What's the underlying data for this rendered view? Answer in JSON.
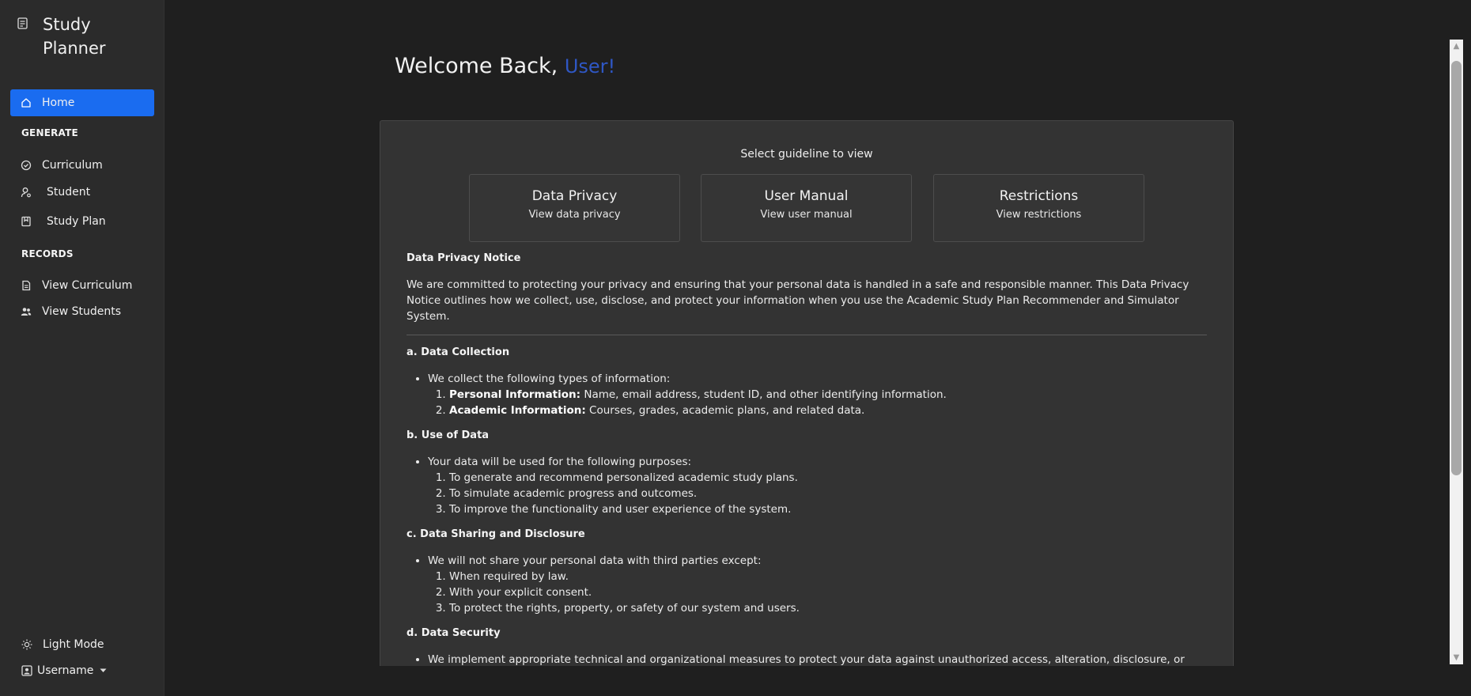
{
  "app": {
    "title": "Study Planner"
  },
  "sidebar": {
    "home": "Home",
    "generate_label": "GENERATE",
    "generate_items": [
      "Curriculum",
      "Student",
      "Study Plan"
    ],
    "records_label": "RECORDS",
    "records_items": [
      "View Curriculum",
      "View Students"
    ],
    "light_mode": "Light Mode",
    "username": "Username",
    "accent": "#1a6cf0"
  },
  "main": {
    "welcome": "Welcome Back,",
    "user": "User!",
    "select_label": "Select guideline to view",
    "cards": [
      {
        "title": "Data Privacy",
        "subtitle": "View data privacy"
      },
      {
        "title": "User Manual",
        "subtitle": "View user manual"
      },
      {
        "title": "Restrictions",
        "subtitle": "View restrictions"
      }
    ],
    "notice": {
      "heading": "Data Privacy Notice",
      "intro": "We are committed to protecting your privacy and ensuring that your personal data is handled in a safe and responsible manner. This Data Privacy Notice outlines how we collect, use, disclose, and protect your information when you use the Academic Study Plan Recommender and Simulator System.",
      "sections": [
        {
          "heading": "a. Data Collection",
          "bullet": "We collect the following types of information:",
          "items": [
            {
              "bold": "Personal Information:",
              "text": " Name, email address, student ID, and other identifying information."
            },
            {
              "bold": "Academic Information:",
              "text": " Courses, grades, academic plans, and related data."
            }
          ]
        },
        {
          "heading": "b. Use of Data",
          "bullet": "Your data will be used for the following purposes:",
          "items": [
            {
              "bold": "",
              "text": "To generate and recommend personalized academic study plans."
            },
            {
              "bold": "",
              "text": "To simulate academic progress and outcomes."
            },
            {
              "bold": "",
              "text": "To improve the functionality and user experience of the system."
            }
          ]
        },
        {
          "heading": "c. Data Sharing and Disclosure",
          "bullet": "We will not share your personal data with third parties except:",
          "items": [
            {
              "bold": "",
              "text": "When required by law."
            },
            {
              "bold": "",
              "text": "With your explicit consent."
            },
            {
              "bold": "",
              "text": "To protect the rights, property, or safety of our system and users."
            }
          ]
        },
        {
          "heading": "d. Data Security",
          "bullet": "We implement appropriate technical and organizational measures to protect your data against unauthorized access, alteration, disclosure, or",
          "items": []
        }
      ]
    }
  },
  "icons": [
    "notebook-icon",
    "home-icon",
    "check-circle-icon",
    "user-icon",
    "bookmark-icon",
    "document-icon",
    "users-icon",
    "sun-icon",
    "user-square-icon",
    "caret-down-icon"
  ]
}
